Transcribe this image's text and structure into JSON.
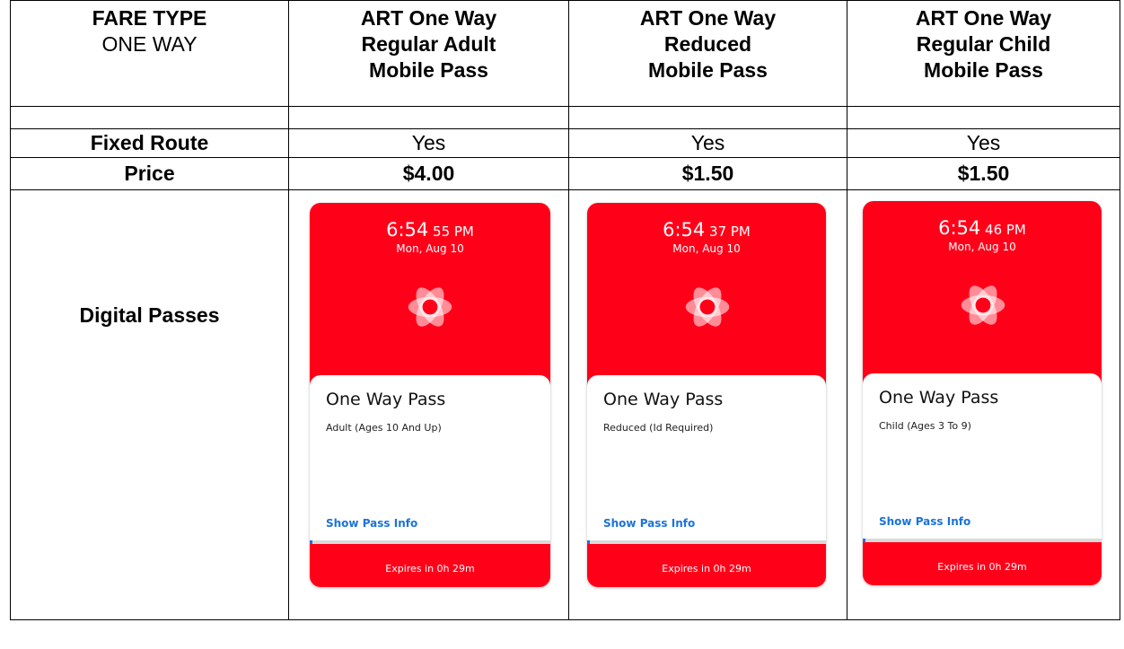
{
  "header": {
    "fare_type_label": "FARE TYPE",
    "fare_type_value": "ONE WAY",
    "columns": [
      {
        "line1": "ART One Way",
        "line2": "Regular Adult",
        "line3": "Mobile Pass"
      },
      {
        "line1": "ART One Way",
        "line2": "Reduced",
        "line3": "Mobile Pass"
      },
      {
        "line1": "ART One Way",
        "line2": "Regular Child",
        "line3": "Mobile Pass"
      }
    ]
  },
  "rows": {
    "fixed_route_label": "Fixed Route",
    "fixed_route_values": [
      "Yes",
      "Yes",
      "Yes"
    ],
    "price_label": "Price",
    "price_values": [
      "$4.00",
      "$1.50",
      "$1.50"
    ],
    "digital_label": "Digital Passes"
  },
  "passes": [
    {
      "time_main": "6:54",
      "time_rest": " 55 PM",
      "date": "Mon, Aug 10",
      "title": "One Way Pass",
      "subtitle": "Adult (Ages 10 And Up)",
      "link": "Show Pass Info",
      "expires": "Expires in 0h 29m",
      "progress": 0.01
    },
    {
      "time_main": "6:54",
      "time_rest": " 37 PM",
      "date": "Mon, Aug 10",
      "title": "One Way Pass",
      "subtitle": "Reduced (Id Required)",
      "link": "Show Pass Info",
      "expires": "Expires in 0h 29m",
      "progress": 0.01
    },
    {
      "time_main": "6:54",
      "time_rest": " 46 PM",
      "date": "Mon, Aug 10",
      "title": "One Way Pass",
      "subtitle": "Child (Ages 3 To 9)",
      "link": "Show Pass Info",
      "expires": "Expires in 0h 29m",
      "progress": 0.01
    }
  ],
  "colors": {
    "pass_red": "#ff0019",
    "link_blue": "#1a73d9"
  },
  "icons": {
    "pass_logo": "flower-logo-icon"
  }
}
